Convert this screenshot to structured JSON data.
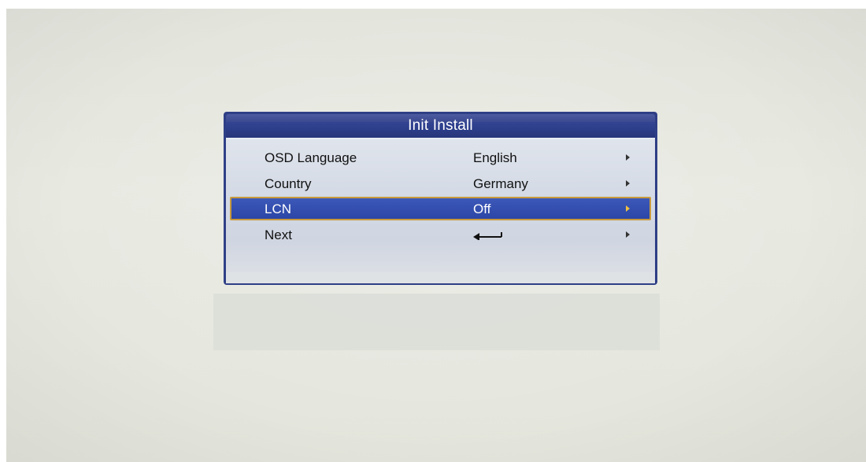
{
  "dialog": {
    "title": "Init Install"
  },
  "menu": {
    "items": [
      {
        "label": "OSD Language",
        "value": "English",
        "selected": false
      },
      {
        "label": "Country",
        "value": "Germany",
        "selected": false
      },
      {
        "label": "LCN",
        "value": "Off",
        "selected": true
      },
      {
        "label": "Next",
        "value_icon": "enter-arrow-icon",
        "selected": false
      }
    ]
  },
  "colors": {
    "frame": "#2f3f86",
    "selection": "#2b46a6",
    "selection_border": "#c89a3c",
    "body": "#d5dbe6"
  }
}
